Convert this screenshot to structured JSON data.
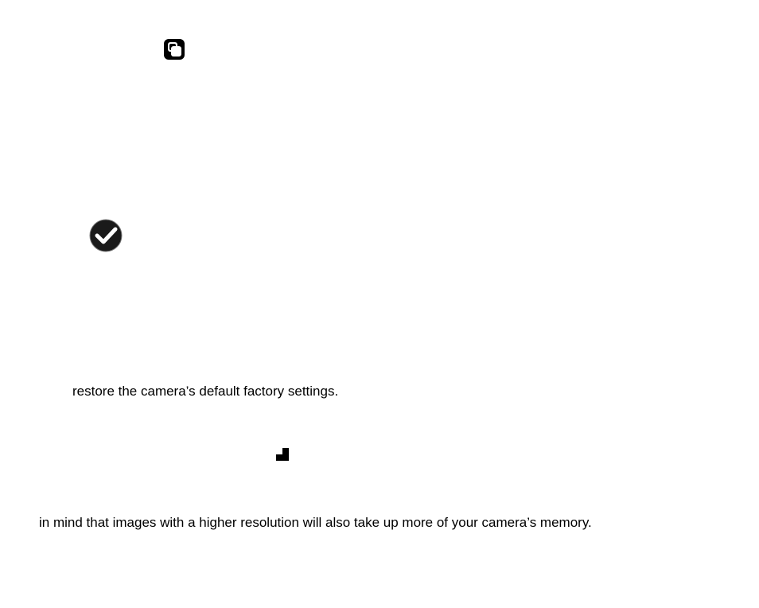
{
  "line1": "restore the camera’s default factory settings.",
  "line2": "in mind that images with a higher resolution will also take up more of your camera’s memory.",
  "icons": {
    "copy": "copy-icon",
    "check": "checkmark-circle-icon",
    "stairs": "stairs-icon"
  }
}
